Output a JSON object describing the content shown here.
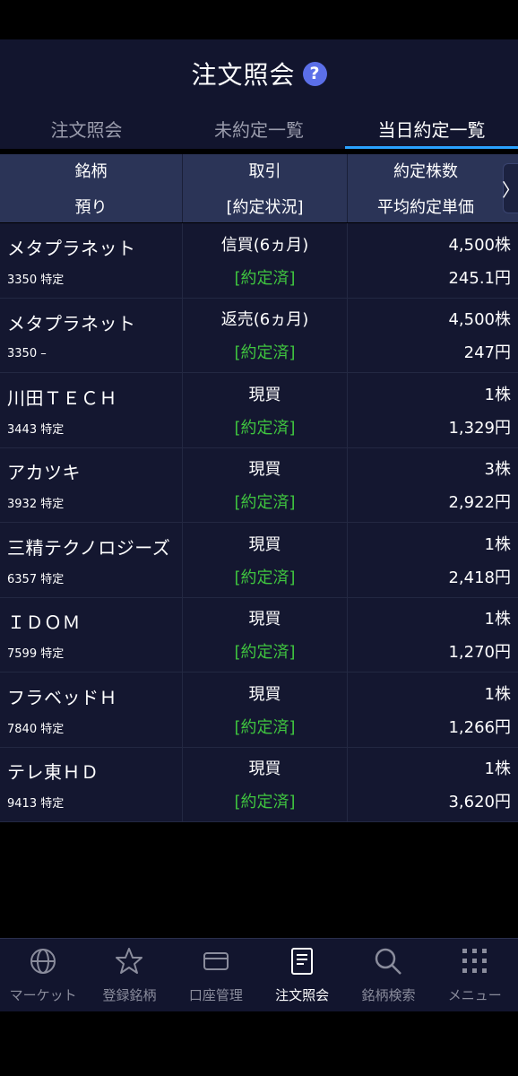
{
  "header": {
    "title": "注文照会",
    "help": "?"
  },
  "tabs": [
    {
      "label": "注文照会",
      "active": false
    },
    {
      "label": "未約定一覧",
      "active": false
    },
    {
      "label": "当日約定一覧",
      "active": true
    }
  ],
  "columns": {
    "c1_top": "銘柄",
    "c1_bottom": "預り",
    "c2_top": "取引",
    "c2_bottom": "[約定状況]",
    "c3_top": "約定株数",
    "c3_bottom": "平均約定単価",
    "scroll": "〉"
  },
  "rows": [
    {
      "name": "メタプラネット",
      "code": "3350 特定",
      "trade": "信買(6ヵ月)",
      "status": "[約定済]",
      "qty": "4,500株",
      "price": "245.1円"
    },
    {
      "name": "メタプラネット",
      "code": "3350 –",
      "trade": "返売(6ヵ月)",
      "status": "[約定済]",
      "qty": "4,500株",
      "price": "247円"
    },
    {
      "name": "川田ＴＥＣＨ",
      "code": "3443 特定",
      "trade": "現買",
      "status": "[約定済]",
      "qty": "1株",
      "price": "1,329円"
    },
    {
      "name": "アカツキ",
      "code": "3932 特定",
      "trade": "現買",
      "status": "[約定済]",
      "qty": "3株",
      "price": "2,922円"
    },
    {
      "name": "三精テクノロジーズ",
      "code": "6357 特定",
      "trade": "現買",
      "status": "[約定済]",
      "qty": "1株",
      "price": "2,418円"
    },
    {
      "name": "ＩＤＯＭ",
      "code": "7599 特定",
      "trade": "現買",
      "status": "[約定済]",
      "qty": "1株",
      "price": "1,270円"
    },
    {
      "name": "フラベッドＨ",
      "code": "7840 特定",
      "trade": "現買",
      "status": "[約定済]",
      "qty": "1株",
      "price": "1,266円"
    },
    {
      "name": "テレ東ＨＤ",
      "code": "9413 特定",
      "trade": "現買",
      "status": "[約定済]",
      "qty": "1株",
      "price": "3,620円"
    }
  ],
  "nav": [
    {
      "label": "マーケット",
      "icon": "globe-icon",
      "active": false
    },
    {
      "label": "登録銘柄",
      "icon": "star-icon",
      "active": false
    },
    {
      "label": "口座管理",
      "icon": "card-icon",
      "active": false
    },
    {
      "label": "注文照会",
      "icon": "document-icon",
      "active": true
    },
    {
      "label": "銘柄検索",
      "icon": "search-icon",
      "active": false
    },
    {
      "label": "メニュー",
      "icon": "grid-menu-icon",
      "active": false
    }
  ],
  "colors": {
    "accent": "#2aa2ff",
    "status_green": "#3fc43f",
    "help_blue": "#5b6fe8",
    "background": "#141730"
  }
}
